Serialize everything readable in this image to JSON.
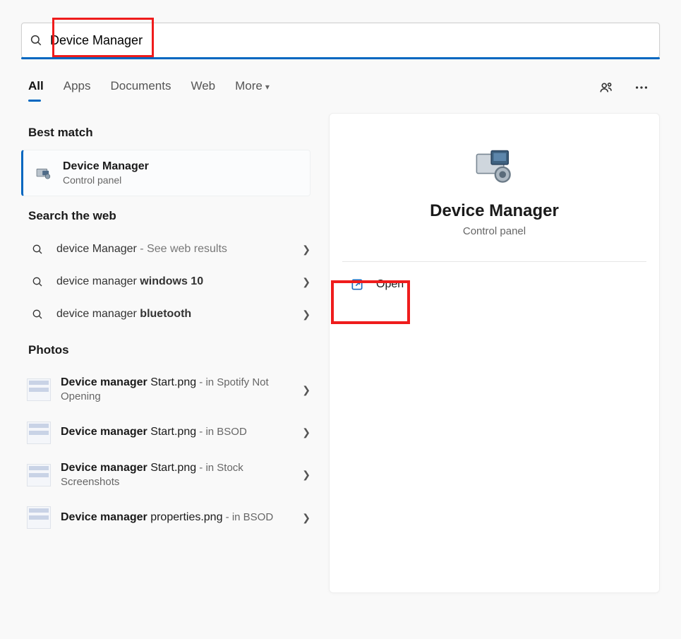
{
  "search": {
    "query": "Device Manager"
  },
  "tabs": {
    "all": "All",
    "apps": "Apps",
    "documents": "Documents",
    "web": "Web",
    "more": "More"
  },
  "sections": {
    "best_match": "Best match",
    "search_web": "Search the web",
    "photos": "Photos"
  },
  "best_match": {
    "title": "Device Manager",
    "subtitle": "Control panel"
  },
  "web_results": [
    {
      "prefix": "device Manager",
      "bold": "",
      "hint": " - See web results"
    },
    {
      "prefix": "device manager ",
      "bold": "windows 10",
      "hint": ""
    },
    {
      "prefix": "device manager ",
      "bold": "bluetooth",
      "hint": ""
    }
  ],
  "photos": [
    {
      "file_bold": "Device manager ",
      "file_rest": "Start.png",
      "loc": " - in Spotify Not Opening"
    },
    {
      "file_bold": "Device manager ",
      "file_rest": "Start.png",
      "loc": " - in BSOD"
    },
    {
      "file_bold": "Device manager ",
      "file_rest": "Start.png",
      "loc": " - in Stock Screenshots"
    },
    {
      "file_bold": "Device manager ",
      "file_rest": "properties.png",
      "loc": " - in BSOD"
    }
  ],
  "preview": {
    "title": "Device Manager",
    "subtitle": "Control panel",
    "open": "Open"
  }
}
